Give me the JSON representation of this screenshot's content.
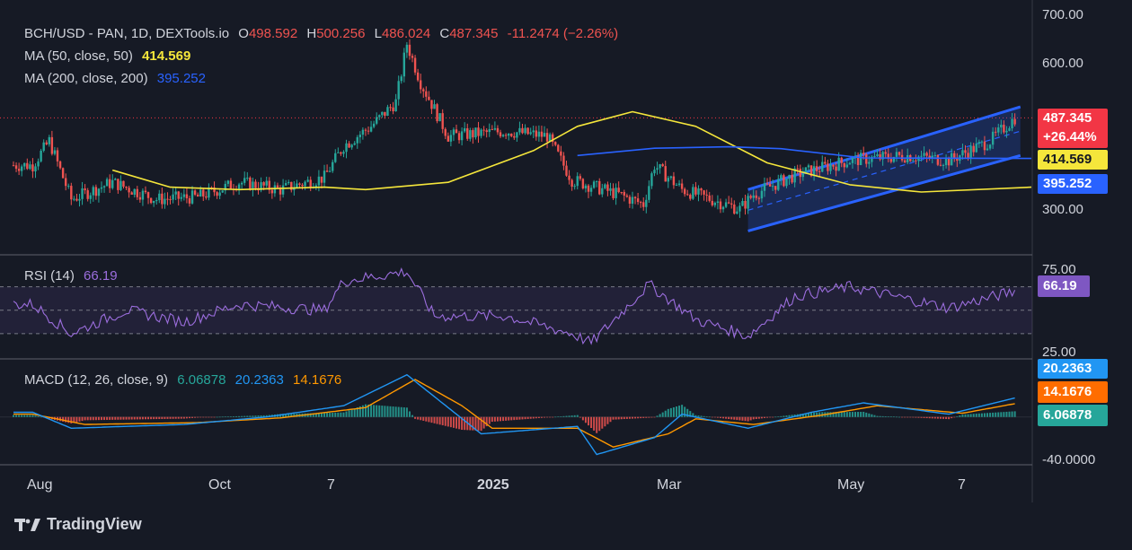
{
  "header": {
    "symbol": "BCH/USD - PAN, 1D, DEXTools.io",
    "o_label": "O",
    "open": "498.592",
    "h_label": "H",
    "high": "500.256",
    "l_label": "L",
    "low": "486.024",
    "c_label": "C",
    "close": "487.345",
    "change": "-11.2474 (−2.26%)"
  },
  "indicators": {
    "ma50": {
      "label": "MA (50, close, 50)",
      "value": "414.569",
      "color": "#f5e63b"
    },
    "ma200": {
      "label": "MA (200, close, 200)",
      "value": "395.252",
      "color": "#2962ff"
    },
    "rsi": {
      "label": "RSI (14)",
      "value": "66.19",
      "color": "#9c6ede"
    },
    "macd": {
      "label": "MACD (12, 26, close, 9)",
      "hist": "6.06878",
      "macd": "20.2363",
      "signal": "14.1676",
      "hist_color": "#26a69a",
      "macd_color": "#2196f3",
      "signal_color": "#ff9800"
    }
  },
  "badges": {
    "price": "487.345",
    "price_change": "+26.44%",
    "ma50": "414.569",
    "ma200": "395.252",
    "rsi": "66.19",
    "macd": "20.2363",
    "signal": "14.1676",
    "hist": "6.06878"
  },
  "y_axis": {
    "price_ticks": [
      "700.00",
      "600.00",
      "300.00"
    ],
    "rsi_ticks": [
      "75.00",
      "25.00"
    ],
    "macd_ticks": [
      "-40.0000"
    ]
  },
  "x_axis": [
    "Aug",
    "Oct",
    "7",
    "2025",
    "Mar",
    "May",
    "7"
  ],
  "footer": {
    "brand": "TradingView"
  },
  "colors": {
    "up": "#26a69a",
    "down": "#ef5350",
    "channel": "#2962ff",
    "background": "#161a25"
  },
  "chart_data": {
    "type": "candlestick",
    "title": "BCH/USD - PAN, 1D, DEXTools.io",
    "x_range": [
      "2024-07-15",
      "2025-07-20"
    ],
    "ylim": [
      200,
      700
    ],
    "price_keypoints": [
      {
        "x": "2024-07-22",
        "y": 390
      },
      {
        "x": "2024-07-28",
        "y": 440
      },
      {
        "x": "2024-08-05",
        "y": 320
      },
      {
        "x": "2024-08-20",
        "y": 355
      },
      {
        "x": "2024-09-05",
        "y": 320
      },
      {
        "x": "2024-09-20",
        "y": 325
      },
      {
        "x": "2024-10-05",
        "y": 355
      },
      {
        "x": "2024-10-20",
        "y": 340
      },
      {
        "x": "2024-11-05",
        "y": 365
      },
      {
        "x": "2024-11-12",
        "y": 430
      },
      {
        "x": "2024-11-22",
        "y": 470
      },
      {
        "x": "2024-12-01",
        "y": 520
      },
      {
        "x": "2024-12-05",
        "y": 640
      },
      {
        "x": "2024-12-10",
        "y": 560
      },
      {
        "x": "2024-12-20",
        "y": 450
      },
      {
        "x": "2025-01-10",
        "y": 460
      },
      {
        "x": "2025-01-25",
        "y": 450
      },
      {
        "x": "2025-02-03",
        "y": 360
      },
      {
        "x": "2025-02-20",
        "y": 330
      },
      {
        "x": "2025-03-01",
        "y": 310
      },
      {
        "x": "2025-03-05",
        "y": 390
      },
      {
        "x": "2025-03-15",
        "y": 340
      },
      {
        "x": "2025-04-05",
        "y": 300
      },
      {
        "x": "2025-04-10",
        "y": 330
      },
      {
        "x": "2025-04-25",
        "y": 370
      },
      {
        "x": "2025-05-15",
        "y": 400
      },
      {
        "x": "2025-06-05",
        "y": 410
      },
      {
        "x": "2025-06-20",
        "y": 400
      },
      {
        "x": "2025-07-05",
        "y": 440
      },
      {
        "x": "2025-07-14",
        "y": 487.345
      }
    ],
    "series": [
      {
        "name": "MA (50, close, 50)",
        "values": [
          {
            "x": "2024-08-20",
            "y": 380
          },
          {
            "x": "2024-09-10",
            "y": 345
          },
          {
            "x": "2024-10-05",
            "y": 340
          },
          {
            "x": "2024-11-05",
            "y": 345
          },
          {
            "x": "2024-11-20",
            "y": 340
          },
          {
            "x": "2024-12-20",
            "y": 355
          },
          {
            "x": "2025-01-20",
            "y": 420
          },
          {
            "x": "2025-02-05",
            "y": 470
          },
          {
            "x": "2025-02-25",
            "y": 500
          },
          {
            "x": "2025-03-20",
            "y": 470
          },
          {
            "x": "2025-04-15",
            "y": 395
          },
          {
            "x": "2025-05-15",
            "y": 350
          },
          {
            "x": "2025-06-10",
            "y": 335
          },
          {
            "x": "2025-07-20",
            "y": 345
          }
        ]
      },
      {
        "name": "MA (200, close, 200)",
        "values": [
          {
            "x": "2025-02-05",
            "y": 410
          },
          {
            "x": "2025-03-05",
            "y": 425
          },
          {
            "x": "2025-04-01",
            "y": 428
          },
          {
            "x": "2025-04-20",
            "y": 424
          },
          {
            "x": "2025-05-20",
            "y": 405
          },
          {
            "x": "2025-07-20",
            "y": 404
          }
        ]
      }
    ],
    "rsi": {
      "ylim": [
        10,
        95
      ],
      "levels": [
        70,
        50,
        30
      ],
      "last": 66.19,
      "keypoints": [
        {
          "x": "2024-07-22",
          "y": 55
        },
        {
          "x": "2024-08-05",
          "y": 30
        },
        {
          "x": "2024-08-25",
          "y": 50
        },
        {
          "x": "2024-09-15",
          "y": 40
        },
        {
          "x": "2024-10-05",
          "y": 55
        },
        {
          "x": "2024-11-05",
          "y": 50
        },
        {
          "x": "2024-11-12",
          "y": 75
        },
        {
          "x": "2024-12-05",
          "y": 83
        },
        {
          "x": "2024-12-15",
          "y": 45
        },
        {
          "x": "2025-01-10",
          "y": 45
        },
        {
          "x": "2025-02-03",
          "y": 30
        },
        {
          "x": "2025-02-10",
          "y": 22
        },
        {
          "x": "2025-03-03",
          "y": 72
        },
        {
          "x": "2025-03-20",
          "y": 42
        },
        {
          "x": "2025-04-08",
          "y": 28
        },
        {
          "x": "2025-04-25",
          "y": 62
        },
        {
          "x": "2025-05-15",
          "y": 70
        },
        {
          "x": "2025-06-20",
          "y": 52
        },
        {
          "x": "2025-07-14",
          "y": 66.19
        }
      ]
    },
    "macd": {
      "ylim": [
        -50,
        60
      ],
      "last": {
        "macd": 20.2363,
        "signal": 14.1676,
        "hist": 6.06878
      },
      "macd_keypoints": [
        {
          "x": "2024-07-22",
          "y": 5
        },
        {
          "x": "2024-08-05",
          "y": -12
        },
        {
          "x": "2024-09-15",
          "y": -8
        },
        {
          "x": "2024-10-15",
          "y": 0
        },
        {
          "x": "2024-11-12",
          "y": 12
        },
        {
          "x": "2024-12-05",
          "y": 45
        },
        {
          "x": "2024-12-20",
          "y": 10
        },
        {
          "x": "2025-01-01",
          "y": -18
        },
        {
          "x": "2025-02-05",
          "y": -10
        },
        {
          "x": "2025-02-12",
          "y": -40
        },
        {
          "x": "2025-03-05",
          "y": -22
        },
        {
          "x": "2025-03-15",
          "y": 3
        },
        {
          "x": "2025-04-08",
          "y": -12
        },
        {
          "x": "2025-05-01",
          "y": 5
        },
        {
          "x": "2025-05-20",
          "y": 15
        },
        {
          "x": "2025-06-20",
          "y": 3
        },
        {
          "x": "2025-07-14",
          "y": 20.2363
        }
      ],
      "signal_keypoints": [
        {
          "x": "2024-07-22",
          "y": 3
        },
        {
          "x": "2024-08-10",
          "y": -8
        },
        {
          "x": "2024-09-20",
          "y": -6
        },
        {
          "x": "2024-10-20",
          "y": -1
        },
        {
          "x": "2024-11-20",
          "y": 10
        },
        {
          "x": "2024-12-08",
          "y": 40
        },
        {
          "x": "2024-12-25",
          "y": 12
        },
        {
          "x": "2025-01-05",
          "y": -12
        },
        {
          "x": "2025-02-05",
          "y": -12
        },
        {
          "x": "2025-02-18",
          "y": -32
        },
        {
          "x": "2025-03-10",
          "y": -18
        },
        {
          "x": "2025-03-20",
          "y": -2
        },
        {
          "x": "2025-04-10",
          "y": -8
        },
        {
          "x": "2025-05-05",
          "y": 2
        },
        {
          "x": "2025-05-25",
          "y": 12
        },
        {
          "x": "2025-06-25",
          "y": 4
        },
        {
          "x": "2025-07-14",
          "y": 14.1676
        }
      ]
    }
  }
}
